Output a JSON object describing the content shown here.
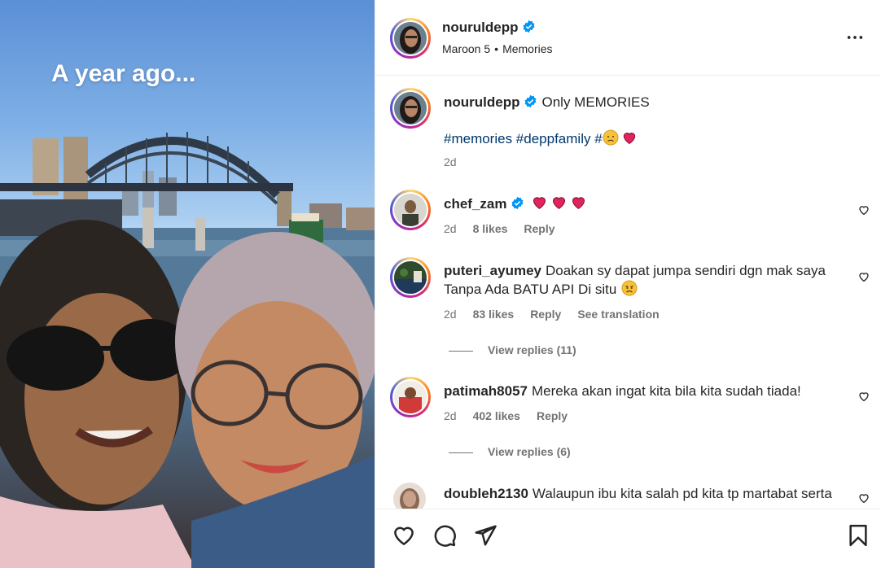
{
  "media": {
    "caption_overlay": "A year ago..."
  },
  "post": {
    "author": "nouruldepp",
    "verified": true,
    "music": "Maroon 5",
    "separator": "•",
    "audio_label": "Memories"
  },
  "caption": {
    "username": "nouruldepp",
    "text": "Only MEMORIES",
    "hashtags": "#memories #deppfamily #",
    "hashtag_emojis": [
      "disappointed-face",
      "heart"
    ],
    "time": "2d"
  },
  "comments": [
    {
      "username": "chef_zam",
      "verified": true,
      "text": "",
      "emojis": [
        "heart",
        "heart",
        "heart"
      ],
      "time": "2d",
      "likes": "8 likes",
      "reply": "Reply",
      "see_translation": "",
      "view_replies": ""
    },
    {
      "username": "puteri_ayumey",
      "verified": false,
      "text": "Doakan sy dapat jumpa sendiri dgn mak saya Tanpa Ada BATU API Di situ",
      "emojis": [
        "sad-face"
      ],
      "time": "2d",
      "likes": "83 likes",
      "reply": "Reply",
      "see_translation": "See translation",
      "view_replies": "View replies (11)"
    },
    {
      "username": "patimah8057",
      "verified": false,
      "text": "Mereka akan ingat kita bila kita sudah tiada!",
      "emojis": [],
      "time": "2d",
      "likes": "402 likes",
      "reply": "Reply",
      "see_translation": "",
      "view_replies": "View replies (6)"
    },
    {
      "username": "doubleh2130",
      "verified": false,
      "text": "Walaupun ibu kita salah pd kita tp martabat serta",
      "emojis": [],
      "time": "",
      "likes": "",
      "reply": "",
      "see_translation": "",
      "view_replies": ""
    }
  ],
  "icons": {
    "more": "more-options-icon",
    "like": "heart-outline-icon",
    "comment": "comment-bubble-icon",
    "share": "paper-plane-icon",
    "save": "bookmark-icon",
    "verified": "verified-badge-icon"
  },
  "colors": {
    "verified": "#0095f6",
    "hashtag": "#00376b",
    "meta_text": "#737373",
    "heart_emoji": "#e0245e",
    "story_ring": [
      "#feda75",
      "#fa7e1e",
      "#d62976",
      "#962fbf",
      "#4f5bd5"
    ]
  }
}
